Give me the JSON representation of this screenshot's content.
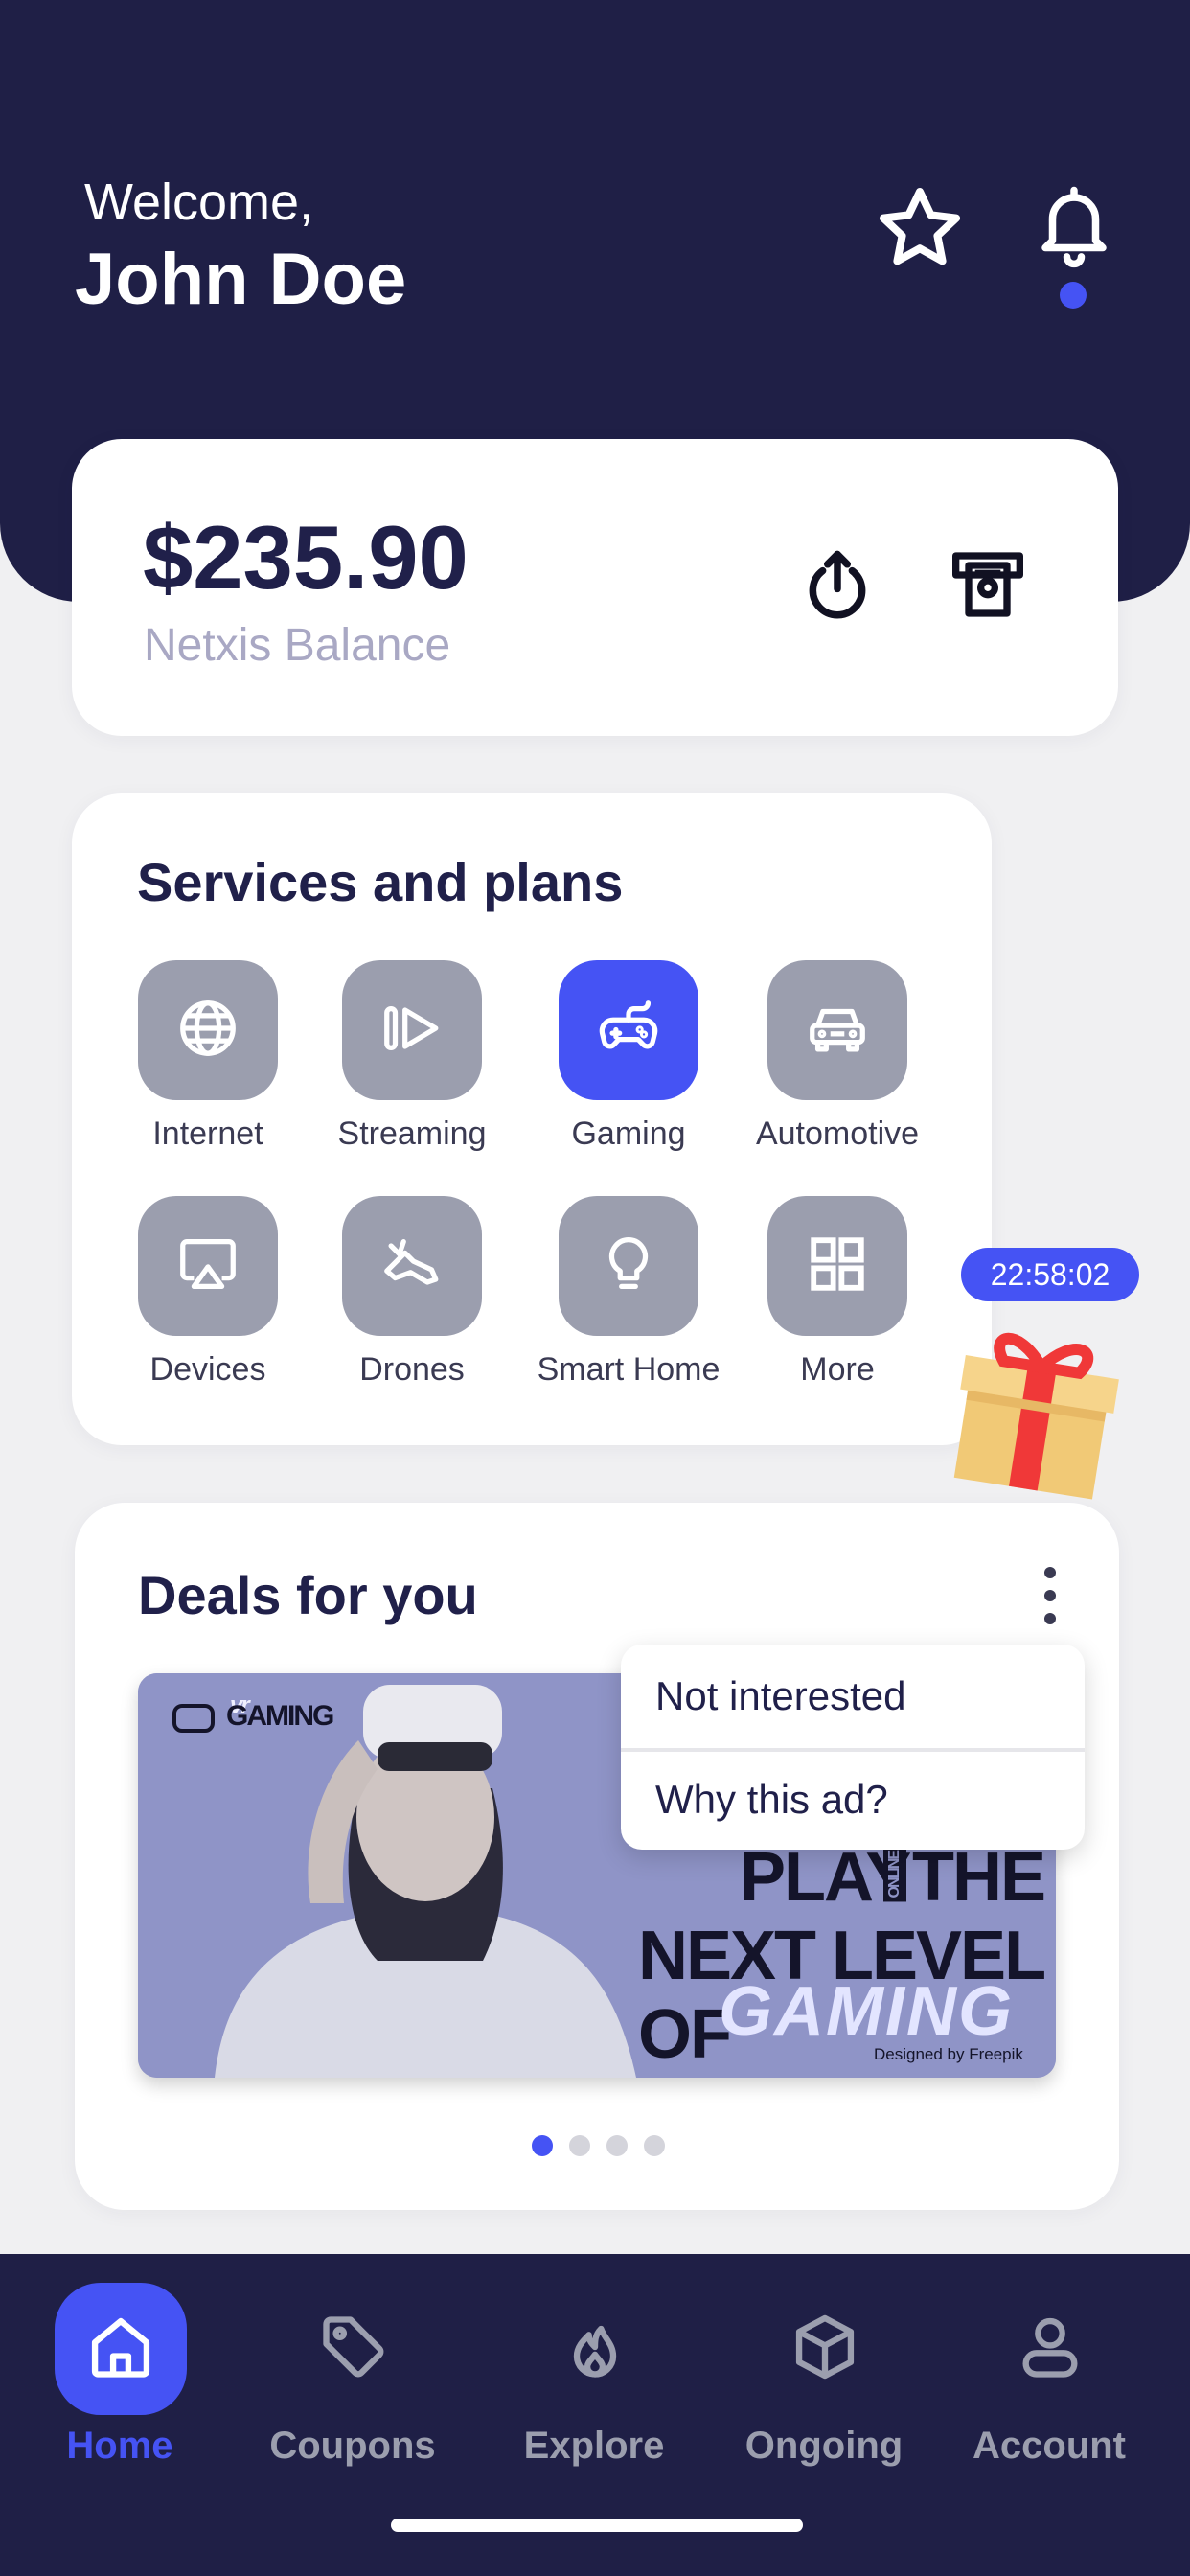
{
  "header": {
    "greeting": "Welcome,",
    "user_name": "John Doe",
    "icons": [
      "star-icon",
      "bell-icon"
    ]
  },
  "balance": {
    "amount": "$235.90",
    "label": "Netxis Balance",
    "actions": [
      "power-icon",
      "cash-icon"
    ]
  },
  "services": {
    "title": "Services and plans",
    "items": [
      {
        "label": "Internet",
        "icon": "globe-icon",
        "active": false
      },
      {
        "label": "Streaming",
        "icon": "stream-icon",
        "active": false
      },
      {
        "label": "Gaming",
        "icon": "gamepad-icon",
        "active": true
      },
      {
        "label": "Automotive",
        "icon": "car-icon",
        "active": false
      },
      {
        "label": "Devices",
        "icon": "airplay-icon",
        "active": false
      },
      {
        "label": "Drones",
        "icon": "drone-icon",
        "active": false
      },
      {
        "label": "Smart Home",
        "icon": "bulb-icon",
        "active": false
      },
      {
        "label": "More",
        "icon": "grid-icon",
        "active": false
      }
    ]
  },
  "promo": {
    "timer": "22:58:02",
    "icon": "gift-icon"
  },
  "deals": {
    "title": "Deals for you",
    "banner": {
      "brand_small": "vr",
      "brand": "GAMING",
      "line1_a": "PLAY",
      "line1_tag": "ONLINE",
      "line1_b": "THE",
      "line2": "NEXT LEVEL OF",
      "line3": "GAMING",
      "credit": "Designed by Freepik"
    },
    "menu": {
      "items": [
        "Not interested",
        "Why this ad?"
      ]
    },
    "carousel": {
      "count": 4,
      "active_index": 0
    }
  },
  "nav": {
    "items": [
      {
        "label": "Home",
        "icon": "home-icon",
        "active": true
      },
      {
        "label": "Coupons",
        "icon": "tag-icon",
        "active": false
      },
      {
        "label": "Explore",
        "icon": "flame-icon",
        "active": false
      },
      {
        "label": "Ongoing",
        "icon": "box-icon",
        "active": false
      },
      {
        "label": "Account",
        "icon": "user-icon",
        "active": false
      }
    ]
  },
  "colors": {
    "primary_dark": "#1f1f46",
    "accent": "#4553f4",
    "tile_gray": "#9b9eae",
    "background": "#f0f0f2"
  }
}
